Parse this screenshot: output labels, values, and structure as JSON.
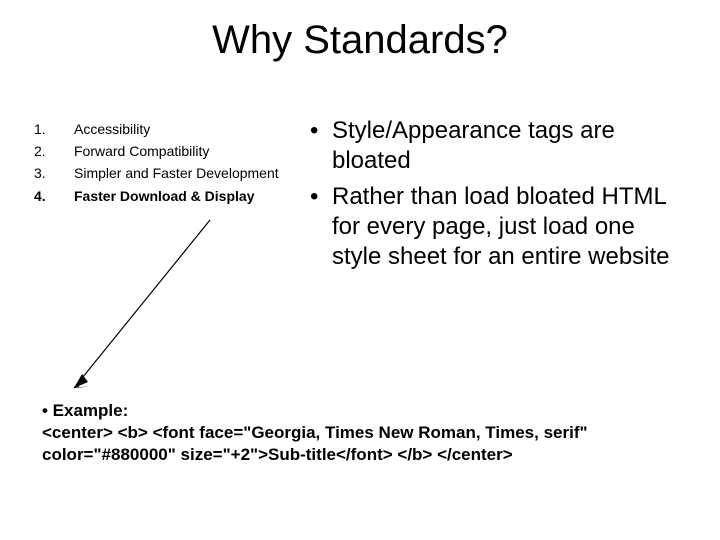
{
  "title": "Why Standards?",
  "left_list": {
    "items": [
      {
        "num": "1.",
        "text": "Accessibility",
        "bold": false
      },
      {
        "num": "2.",
        "text": "Forward Compatibility",
        "bold": false
      },
      {
        "num": "3.",
        "text": "Simpler and Faster Development",
        "bold": false
      },
      {
        "num": "4.",
        "text": "Faster Download & Display",
        "bold": true
      }
    ]
  },
  "right_list": {
    "bullets": [
      "Style/Appearance tags are bloated",
      "Rather than load bloated HTML for every page, just load one style sheet for an entire website"
    ]
  },
  "example": {
    "label": "• Example:",
    "code": "<center> <b> <font face=\"Georgia, Times New Roman, Times, serif\" color=\"#880000\" size=\"+2\">Sub-title</font> </b> </center>"
  }
}
